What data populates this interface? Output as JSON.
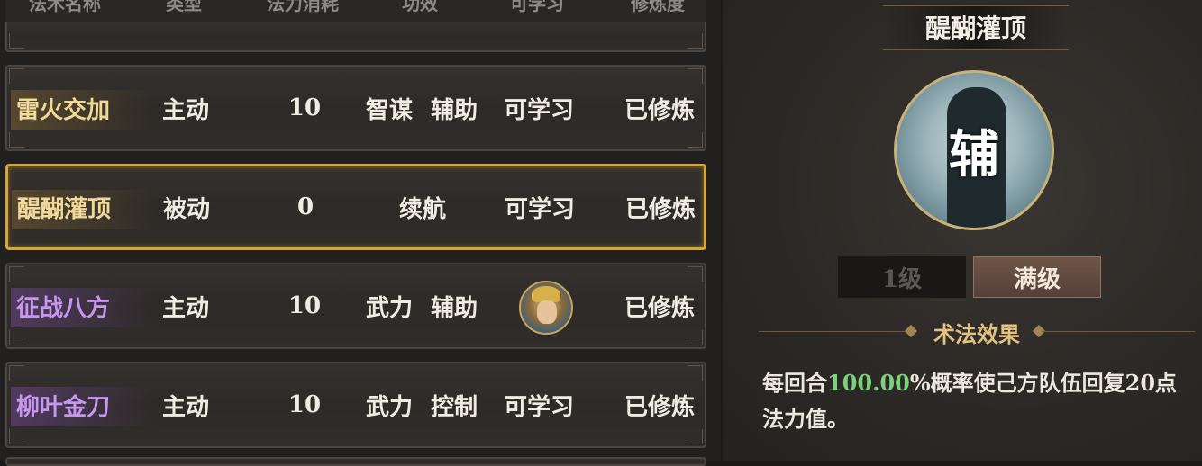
{
  "table": {
    "headers": [
      "法术名称",
      "类型",
      "法力消耗",
      "功效",
      "可学习",
      "修炼度"
    ],
    "rows": [
      {
        "name": "雷火交加",
        "type": "主动",
        "cost": "10",
        "effect1": "智谋",
        "effect2": "辅助",
        "learn": "可学习",
        "progress": "已修炼",
        "name_color": "gold"
      },
      {
        "name": "醍醐灌顶",
        "type": "被动",
        "cost": "0",
        "effect": "续航",
        "learn": "可学习",
        "progress": "已修炼",
        "name_color": "gold",
        "selected": true
      },
      {
        "name": "征战八方",
        "type": "主动",
        "cost": "10",
        "effect1": "武力",
        "effect2": "辅助",
        "learn_icon": "general-portrait-icon",
        "progress": "已修炼",
        "name_color": "purple"
      },
      {
        "name": "柳叶金刀",
        "type": "主动",
        "cost": "10",
        "effect1": "武力",
        "effect2": "控制",
        "learn": "可学习",
        "progress": "已修炼",
        "name_color": "purple"
      }
    ]
  },
  "detail": {
    "title": "醍醐灌顶",
    "emblem_glyph": "辅",
    "emblem_icon": "scholar-silhouette-icon",
    "level_buttons": [
      "1级",
      "满级"
    ],
    "selected_level": "满级",
    "effect_header": "术法效果",
    "effect_text_pre": "每回合",
    "effect_text_value": "100.00",
    "effect_text_post": "%概率使己方队伍回复20点法力值。"
  },
  "colors": {
    "accent_gold": "#d7a63a",
    "name_gold": "#f0d99a",
    "name_purple": "#c597ee",
    "highlight_green": "#7bd27a"
  }
}
